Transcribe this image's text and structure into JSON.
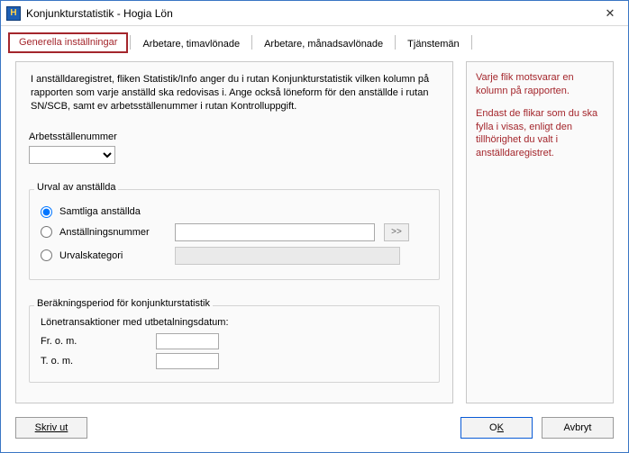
{
  "window": {
    "title": "Konjunkturstatistik - Hogia Lön",
    "icon_letter": "H"
  },
  "tabs": {
    "items": [
      {
        "label": "Generella inställningar",
        "active": true
      },
      {
        "label": "Arbetare, timavlönade",
        "active": false
      },
      {
        "label": "Arbetare, månadsavlönade",
        "active": false
      },
      {
        "label": "Tjänstemän",
        "active": false
      }
    ]
  },
  "intro_text": "I anställdaregistret, fliken Statistik/Info anger du i rutan Konjunkturstatistik vilken kolumn på rapporten som varje anställd ska redovisas i. Ange också löneform för den anställde i rutan SN/SCB, samt ev arbetsställenummer i rutan Kontrolluppgift.",
  "arbetsstalle": {
    "label": "Arbetsställenummer",
    "value": ""
  },
  "urval": {
    "group_label": "Urval av anställda",
    "options": {
      "samtliga": "Samtliga anställda",
      "anstallningsnummer": "Anställningsnummer",
      "urvalskategori": "Urvalskategori"
    },
    "selected": "samtliga",
    "anst_nr_value": "",
    "chooser_label": ">>",
    "urvalskategori_value": ""
  },
  "period": {
    "group_label": "Beräkningsperiod för konjunkturstatistik",
    "sub_label": "Lönetransaktioner med utbetalningsdatum:",
    "from_label": "Fr. o. m.",
    "to_label": "T. o. m.",
    "from_value": "",
    "to_value": ""
  },
  "side_info": {
    "p1": "Varje flik motsvarar en kolumn på rapporten.",
    "p2": "Endast de flikar som du ska fylla i visas, enligt den tillhörighet du valt i anställdaregistret."
  },
  "buttons": {
    "print": "Skriv ut",
    "ok_pre": "O",
    "ok_key": "K",
    "cancel": "Avbryt"
  }
}
